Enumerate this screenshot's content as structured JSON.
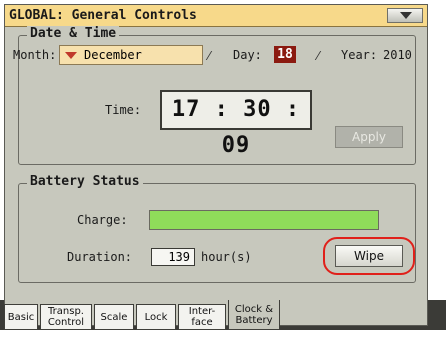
{
  "window": {
    "title": "GLOBAL: General Controls"
  },
  "date_time": {
    "legend": "Date & Time",
    "month_label": "Month:",
    "month_value": "December",
    "day_label": "Day:",
    "day_value": "18",
    "year_label": "Year:",
    "year_value": "2010",
    "time_label": "Time:",
    "time_value": "17 : 30 : 09",
    "apply_label": "Apply"
  },
  "battery": {
    "legend": "Battery Status",
    "charge_label": "Charge:",
    "charge_level": 1.0,
    "duration_label": "Duration:",
    "duration_value": "139",
    "duration_unit": "hour(s)",
    "wipe_label": "Wipe"
  },
  "tabs": [
    {
      "label": "Basic"
    },
    {
      "label": "Transp.\nControl"
    },
    {
      "label": "Scale"
    },
    {
      "label": "Lock"
    },
    {
      "label": "Inter-\nface"
    },
    {
      "label": "Clock &\nBattery",
      "active": true
    }
  ],
  "colors": {
    "title_bar": "#f7d98a",
    "panel": "#c7c8bd",
    "day_field": "#8b1a10",
    "charge_bar": "#8fdc5a",
    "highlight_ring": "#e0201a"
  }
}
